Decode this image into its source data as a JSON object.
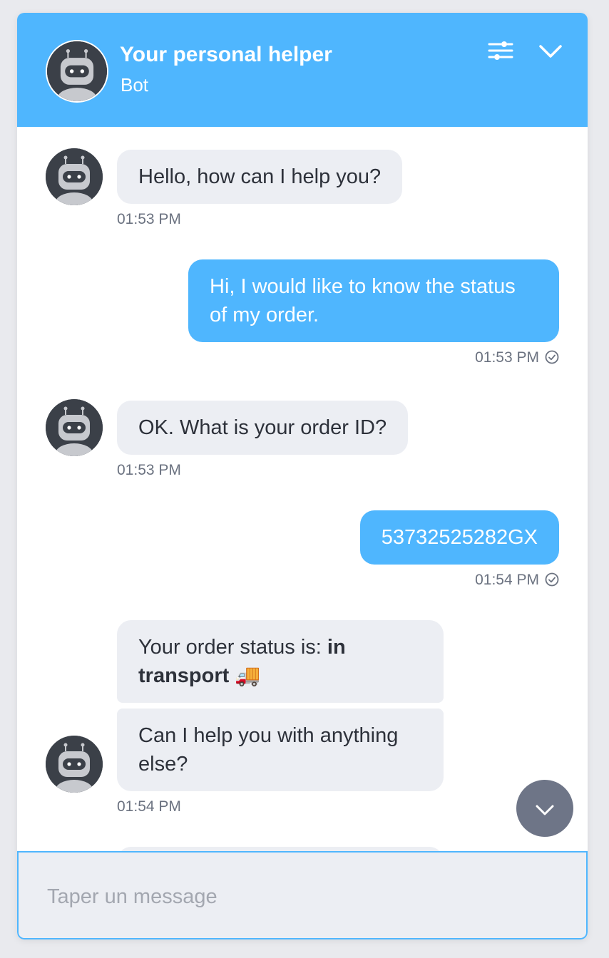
{
  "header": {
    "title": "Your personal helper",
    "subtitle": "Bot"
  },
  "messages": [
    {
      "sender": "bot",
      "text": "Hello, how can I help you?",
      "time": "01:53 PM"
    },
    {
      "sender": "user",
      "text": "Hi, I would like to know the status of my order.",
      "time": "01:53 PM",
      "status": "sent"
    },
    {
      "sender": "bot",
      "text": "OK. What is your order ID?",
      "time": "01:53 PM"
    },
    {
      "sender": "user",
      "text": "53732525282GX",
      "time": "01:54 PM",
      "status": "sent"
    },
    {
      "sender": "bot",
      "text_prefix": "Your order status is:",
      "text_bold": "in transport",
      "emoji": "🚚",
      "time": ""
    },
    {
      "sender": "bot",
      "text": "Can I help you with anything else?",
      "time": "01:54 PM"
    }
  ],
  "composer": {
    "placeholder": "Taper un message",
    "value": ""
  },
  "icons": {
    "header_avatar": "robot-icon",
    "settings": "sliders-icon",
    "collapse": "chevron-down-icon",
    "scroll": "chevron-down-icon",
    "read_receipt": "check-circle-icon"
  },
  "colors": {
    "accent": "#4fb6fe",
    "bot_bubble": "#eceef3",
    "avatar_bg": "#3b4048",
    "scroll_button": "#6e7587"
  }
}
